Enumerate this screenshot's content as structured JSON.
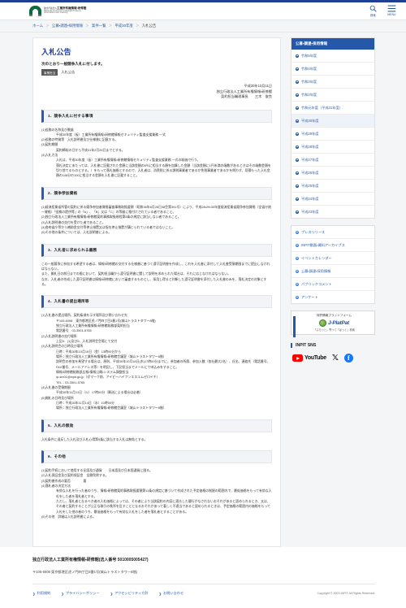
{
  "header": {
    "logo": {
      "ja_small": "独立行政法人",
      "ja_main": "工業所有権情報・研修館",
      "en_line1": "National Center for Industrial Property",
      "en_line2": "Information and Training"
    },
    "search_label": "検索",
    "menu_label": "MENU"
  },
  "breadcrumb": {
    "home": "ホーム",
    "level2": "公募・調達・採用情報",
    "level3": "案件一覧",
    "level4": "平成30年度",
    "current": "入札公告",
    "separator": "＞"
  },
  "main": {
    "title": "入札公告",
    "lead": "次のとおり一般競争入札に付します。",
    "badge": "事業担当",
    "badge_text": "入札公告",
    "meta": {
      "date": "平成30年10月11日",
      "org": "独立行政法人工業所有権情報・研修館",
      "signer": "契約担当職理事長　　三木　俊克"
    },
    "sections": [
      {
        "heading": "1．競争入札に付する事項",
        "lines": [
          {
            "indent": 0,
            "text": "(1)役務の名称及び数量"
          },
          {
            "indent": 2,
            "text": "平成30年度（仮）工業所有権情報・研修館情報セキュリティ監査支援業務 一式"
          },
          {
            "indent": 0,
            "text": "(2)役務の特質等　入札説明書及び仕様書に記載する。"
          },
          {
            "indent": 0,
            "text": "(3)契約期間"
          },
          {
            "indent": 2,
            "text": "契約締結の日から平成31年2月28日までとする。"
          },
          {
            "indent": 0,
            "text": "(4)入札方法"
          },
          {
            "indent": 2,
            "text": "入札は、平成30年度（仮）工業所有権情報・研修館情報セキュリティ監査支援業務 一式の総価で行う。"
          },
          {
            "indent": 2,
            "text": "落札決定にあたっては、入札書に記載された金額に当該金額の8％に相当する額を加算した金額（当該金額に1円未満の端数があるときはその端数金額を切り捨てるものとする。）をもって落札価格とするので、入札者は、消費税に係る課税事業者であるか免税事業者であるかを問わず、見積もった入札金額の108分の100に相当する金額を入札書に記載すること。"
          }
        ]
      },
      {
        "heading": "2．競争参加資格",
        "lines": [
          {
            "indent": 0,
            "text": "(1)経済産業省所管の契約に係る競争参加者資格審査事務取扱要領（昭和38年6月26日38会第391号）により、平成28・29・30年度経済産業省競争参加資格（全省庁統一資格）「役務の提供等」の「A」、「B」又は「C」の等級に格付けされている者であること。"
          },
          {
            "indent": 0,
            "text": "(2)独立行政法人工業所有権情報・研修館契約事務取扱規程第8条の規定に該当しない者であること。"
          },
          {
            "indent": 0,
            "text": "(3)入札説明書の交付を受けた者であること。"
          },
          {
            "indent": 0,
            "text": "(4)各府省庁等から補助金交付等停止措置又は指名停止措置が講じられている者ではないこと。"
          },
          {
            "indent": 0,
            "text": "(5)その他の条件については、入札説明書による。"
          }
        ]
      },
      {
        "heading": "3．入札者に求められる義務",
        "lines": [
          {
            "indent": 0,
            "text": "この一般競争に参加する希望する者は、情報・研修館の交付する仕様書に基づく遵守証明書を作成し、これを入札書に添付して入札書受領期限までに提出しなければならない。"
          },
          {
            "indent": 0,
            "text": "また、開札日の前日までの間において、契約担当職から遵守証明書に関して説明を求められた場合は、それに応じなければならない。"
          },
          {
            "indent": 0,
            "text": "なお、入札者の作成した遵守証明書は情報・研修館において審査するものとし、採用し得ると判断した遵守証明書を添付した入札書のみを、落札決定の対象とする。"
          }
        ]
      },
      {
        "heading": "4．入札書の提出場所等",
        "lines": [
          {
            "indent": 0,
            "text": "(1)入札書の提出場所、契約条項を示す場所及び問い合わせ先"
          },
          {
            "indent": 2,
            "text": "〒105-6008　東京都港区虎ノ門四丁目3番1号(城山トラストタワー8階)"
          },
          {
            "indent": 2,
            "text": "独立行政法人工業所有権情報・研修館総務部契約担当"
          },
          {
            "indent": 2,
            "text": "電話番号　03-3501-5765"
          },
          {
            "indent": 0,
            "text": "(2)入札説明書の交付場所"
          },
          {
            "indent": 2,
            "text": "上記4．(1)及び5．入札説明会会場にて交付"
          },
          {
            "indent": 0,
            "text": "(3)入札説明会の日時及び場所"
          },
          {
            "indent": 2,
            "text": "日時：平成30年10月19日（金）13時00分から"
          },
          {
            "indent": 2,
            "text": "場所：独立行政法人工業所有権情報・研修館会議室（城山トラストタワー8階）"
          },
          {
            "indent": 2,
            "text": "説明会の参加を希望する場合は、原則、平成30年10月18日(木)17時00分までに、参加者の所属、参加人数（各社最大2名）、氏名、連絡先（電話番号、FAX番号、メールアドレス等）を明記し、下記担当までメールにて申込みをすること。"
          },
          {
            "indent": 2,
            "text": "情報・研修館総務部広報・情報公開・システム調整担当"
          },
          {
            "indent": 2,
            "text": "ip-sm01@inpit.go.jp（＠マーク前、アイピーハイフンエスエムゼロイチ）"
          },
          {
            "indent": 2,
            "text": "TEL：03-3501-5765"
          },
          {
            "indent": 0,
            "text": "(4)入札書の受領期限"
          },
          {
            "indent": 2,
            "text": "平成30年11月13日（火）17時00分（郵送による場合は必着）"
          },
          {
            "indent": 0,
            "text": "(5)開札の日時及び場所"
          },
          {
            "indent": 2,
            "text": "日時：平成30年11月14日（水）10時00分"
          },
          {
            "indent": 2,
            "text": "場所：独立行政法人工業所有権情報・研修館会議室（城山トラストタワー8階）"
          }
        ]
      },
      {
        "heading": "5．入札の無効",
        "lines": [
          {
            "indent": 0,
            "text": "入札条件に違反した入札及び入札心得第9条に該当する入札は無効とする。"
          }
        ]
      },
      {
        "heading": "6．その他",
        "lines": [
          {
            "indent": 0,
            "text": "(1)契約手続において使用する言語及び通貨　　日本語及び日本国通貨に限る。"
          },
          {
            "indent": 0,
            "text": "(2)入札保証金及び契約保証金　全額免除する。"
          },
          {
            "indent": 0,
            "text": "(3)契約書作成の要否　　　　要"
          },
          {
            "indent": 0,
            "text": "(4)落札者の決定方法"
          },
          {
            "indent": 2,
            "text": "有効な入札を行った者のうち、情報・研修館契約事務取扱要領第11条の規定に基づいて作成された予定価格の制限の範囲内で、最低価格をもって有効な入札をした者を落札者とする。"
          },
          {
            "indent": 2,
            "text": "ただし、落札者となるべき者の入札価格によっては、その者により当該契約の内容に適合した履行がなされないおそれがあると認められるとき、又は、その者と契約することが公正な取引の秩序を乱すこととなるおそれがあって著しく不適当であると認められるときは、予定価格の範囲内の価格をもって入札をした他の者のうち、最低価格をもって有効な入札をした者を落札者とすることがある。"
          },
          {
            "indent": 0,
            "text": "(5)その他　詳細は入札説明書による。"
          }
        ]
      }
    ]
  },
  "sidebar": {
    "panel_title": "公募・調達・採用情報",
    "years": [
      {
        "label": "令和5年度",
        "active": false
      },
      {
        "label": "令和4年度",
        "active": false
      },
      {
        "label": "令和3年度",
        "active": false
      },
      {
        "label": "令和2年度",
        "active": false
      },
      {
        "label": "令和元年度（平成31年度）",
        "active": false
      },
      {
        "label": "平成30年度",
        "active": true
      },
      {
        "label": "平成29年度",
        "active": false
      },
      {
        "label": "平成28年度",
        "active": false
      },
      {
        "label": "平成27年度",
        "active": false
      },
      {
        "label": "平成26年度",
        "active": false
      },
      {
        "label": "平成25年度",
        "active": false
      },
      {
        "label": "平成24年度",
        "active": false
      },
      {
        "label": "平成23年度",
        "active": false
      }
    ],
    "links": [
      {
        "label": "プレスリリース"
      },
      {
        "label": "INPIT動画・資料アーカイブス"
      },
      {
        "label": "イベントカレンダー"
      },
      {
        "label": "公募・調達・採用情報"
      },
      {
        "label": "パブリックコメント"
      },
      {
        "label": "アンケート"
      }
    ],
    "banner": {
      "caption": "特許情報プラットフォーム",
      "brand_prefix": "J-",
      "brand_main": "PlatPat",
      "tagline": "「ぷらっと」寄って「ぱっと」検索"
    },
    "sns": {
      "title": "INPIT SNS",
      "youtube": "YouTube",
      "x": "𝕏",
      "facebook": "f"
    }
  },
  "footer": {
    "org": "独立行政法人工業所有権情報・研修館(法人番号 5010005005427)",
    "address": "〒105-6008 東京都港区虎ノ門四丁目3番1号(城山トラストタワー8階)",
    "links": [
      {
        "label": "利用規約"
      },
      {
        "label": "プライバシーポリシー"
      },
      {
        "label": "アクセシビリティ方針"
      },
      {
        "label": "お問い合わせ"
      }
    ],
    "copyright": "Copyright © 2023 INPIT All Rights Reserved."
  },
  "colors": {
    "brand_blue": "#2558a8",
    "accent_bar": "#1f3f94",
    "link_blue": "#2a5ca8",
    "page_bg": "#f4f5f7"
  }
}
